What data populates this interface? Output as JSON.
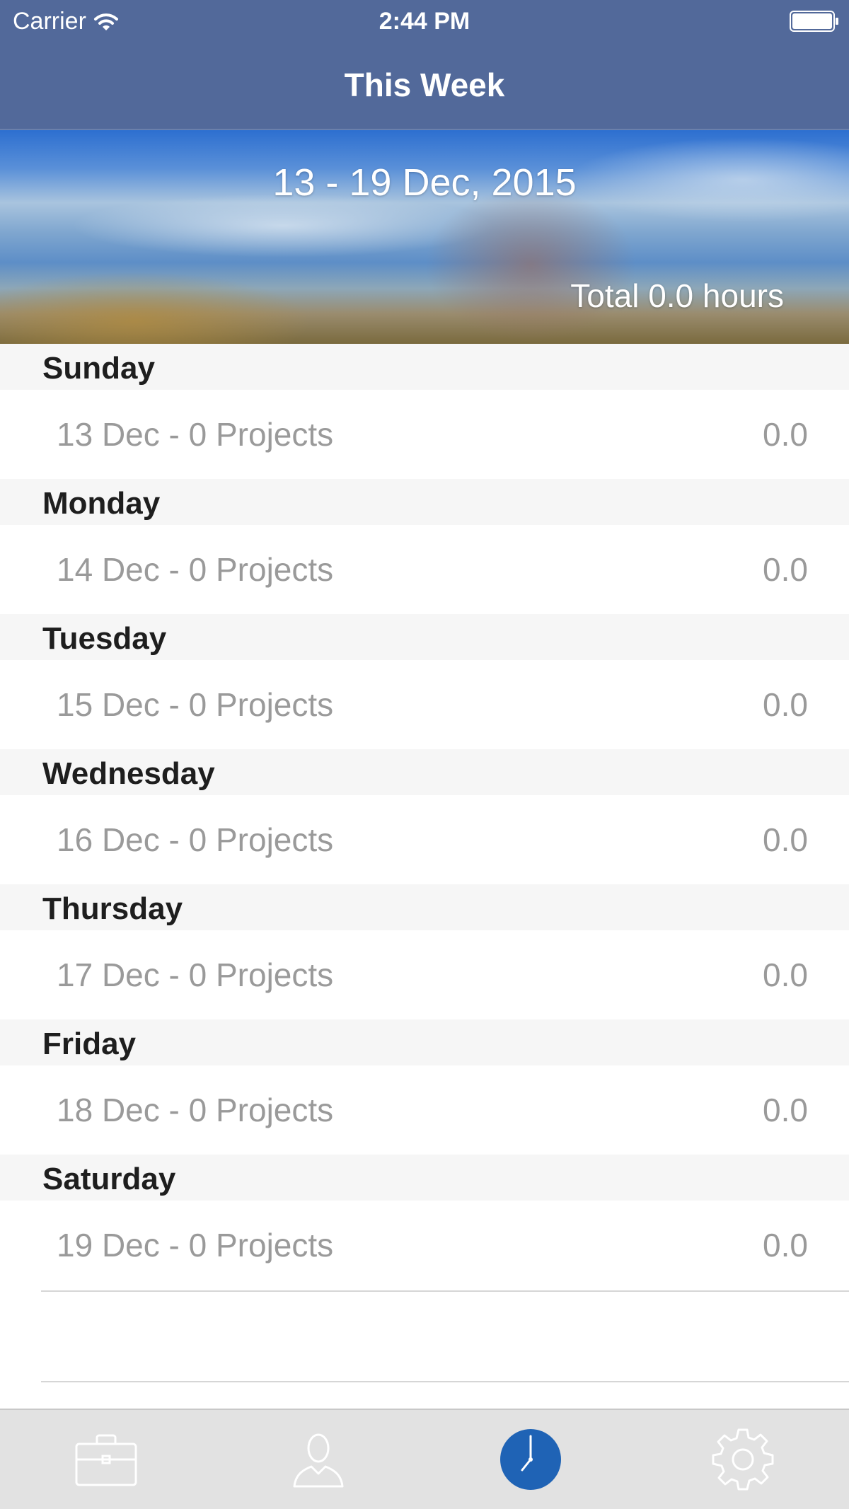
{
  "status_bar": {
    "carrier": "Carrier",
    "time": "2:44 PM",
    "wifi_icon": "wifi-icon",
    "battery_icon": "battery-icon"
  },
  "nav": {
    "title": "This Week"
  },
  "hero": {
    "date_range": "13 - 19 Dec, 2015",
    "total": "Total 0.0 hours"
  },
  "days": [
    {
      "name": "Sunday",
      "summary": "13 Dec - 0 Projects",
      "hours": "0.0"
    },
    {
      "name": "Monday",
      "summary": "14 Dec - 0 Projects",
      "hours": "0.0"
    },
    {
      "name": "Tuesday",
      "summary": "15 Dec - 0 Projects",
      "hours": "0.0"
    },
    {
      "name": "Wednesday",
      "summary": "16 Dec - 0 Projects",
      "hours": "0.0"
    },
    {
      "name": "Thursday",
      "summary": "17 Dec - 0 Projects",
      "hours": "0.0"
    },
    {
      "name": "Friday",
      "summary": "18 Dec - 0 Projects",
      "hours": "0.0"
    },
    {
      "name": "Saturday",
      "summary": "19 Dec - 0 Projects",
      "hours": "0.0"
    }
  ],
  "tabbar": {
    "tabs": [
      {
        "icon": "briefcase-icon",
        "selected": false
      },
      {
        "icon": "person-icon",
        "selected": false
      },
      {
        "icon": "clock-icon",
        "selected": true
      },
      {
        "icon": "gear-icon",
        "selected": false
      }
    ]
  },
  "colors": {
    "nav_background": "#52699a",
    "section_header_background": "#f6f6f6",
    "row_text": "#9a9a9a",
    "header_text": "#1e1e1e",
    "tab_selected": "#1f63b5",
    "tab_unselected": "#ffffff",
    "tabbar_background": "#e2e2e2"
  }
}
